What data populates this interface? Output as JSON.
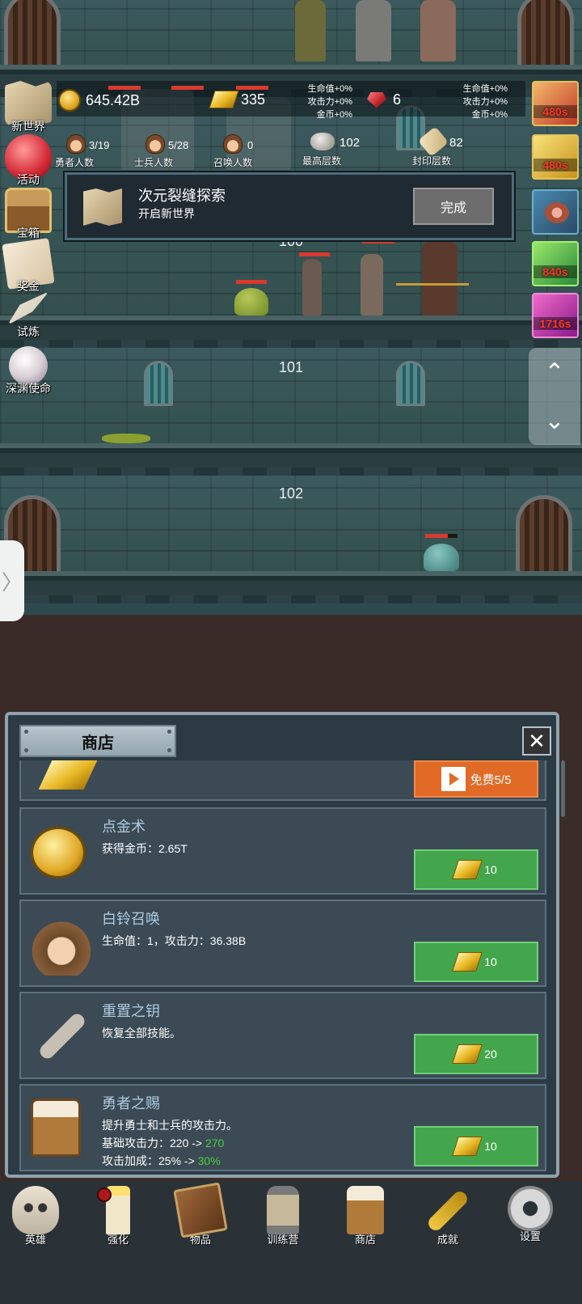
{
  "resources": {
    "gold": "645.42B",
    "gold_bars": "335",
    "rubies": "6"
  },
  "bonus_left": {
    "hp": "生命值+0%",
    "atk": "攻击力+0%",
    "gold": "金币+0%"
  },
  "bonus_right": {
    "hp": "生命值+0%",
    "atk": "攻击力+0%",
    "gold": "金币+0%"
  },
  "stats": [
    {
      "value": "3/19",
      "label": "勇者人数"
    },
    {
      "value": "5/28",
      "label": "士兵人数"
    },
    {
      "value": "0",
      "label": "召唤人数"
    },
    {
      "value": "102",
      "label": "最高层数"
    },
    {
      "value": "82",
      "label": "封印层数"
    }
  ],
  "left_menu": [
    {
      "label": "新世界"
    },
    {
      "label": "活动"
    },
    {
      "label": "宝箱"
    },
    {
      "label": "奖金"
    },
    {
      "label": "试炼"
    },
    {
      "label": "深渊使命"
    }
  ],
  "right_column": [
    {
      "timer": "480s",
      "icon": "crown-chest-icon"
    },
    {
      "timer": "480s",
      "icon": "gold-chest-icon"
    },
    {
      "timer": "",
      "icon": "meat-icon"
    },
    {
      "timer": "840s",
      "icon": "green-chest-icon"
    },
    {
      "timer": "1716s",
      "icon": "pink-chest-icon"
    }
  ],
  "scroll_controls": {
    "up": "⌃",
    "down": "⌄"
  },
  "side_tab": "〉",
  "floors": [
    {
      "number": "100"
    },
    {
      "number": "101"
    },
    {
      "number": "102"
    }
  ],
  "popup": {
    "title": "次元裂缝探索",
    "subtitle": "开启新世界",
    "button": "完成"
  },
  "shop": {
    "title": "商店",
    "close": "✕",
    "ad_button": "免费5/5",
    "items": [
      {
        "name": "点金术",
        "desc": [
          "获得金币：2.65T"
        ],
        "price": "10"
      },
      {
        "name": "白铃召唤",
        "desc": [
          "生命值：1，攻击力：36.38B"
        ],
        "price": "10"
      },
      {
        "name": "重置之钥",
        "desc": [
          "恢复全部技能。"
        ],
        "price": "20"
      },
      {
        "name": "勇者之赐",
        "desc": [
          "提升勇士和士兵的攻击力。"
        ],
        "desc2_prefix": "基础攻击力：220 -> ",
        "desc2_new": "270",
        "desc3_prefix": "攻击加成：25% -> ",
        "desc3_new": "30%",
        "price": "10"
      }
    ]
  },
  "bottom_nav": [
    {
      "label": "英雄"
    },
    {
      "label": "强化"
    },
    {
      "label": "物品"
    },
    {
      "label": "训练营"
    },
    {
      "label": "商店"
    },
    {
      "label": "成就"
    },
    {
      "label": "设置"
    }
  ]
}
